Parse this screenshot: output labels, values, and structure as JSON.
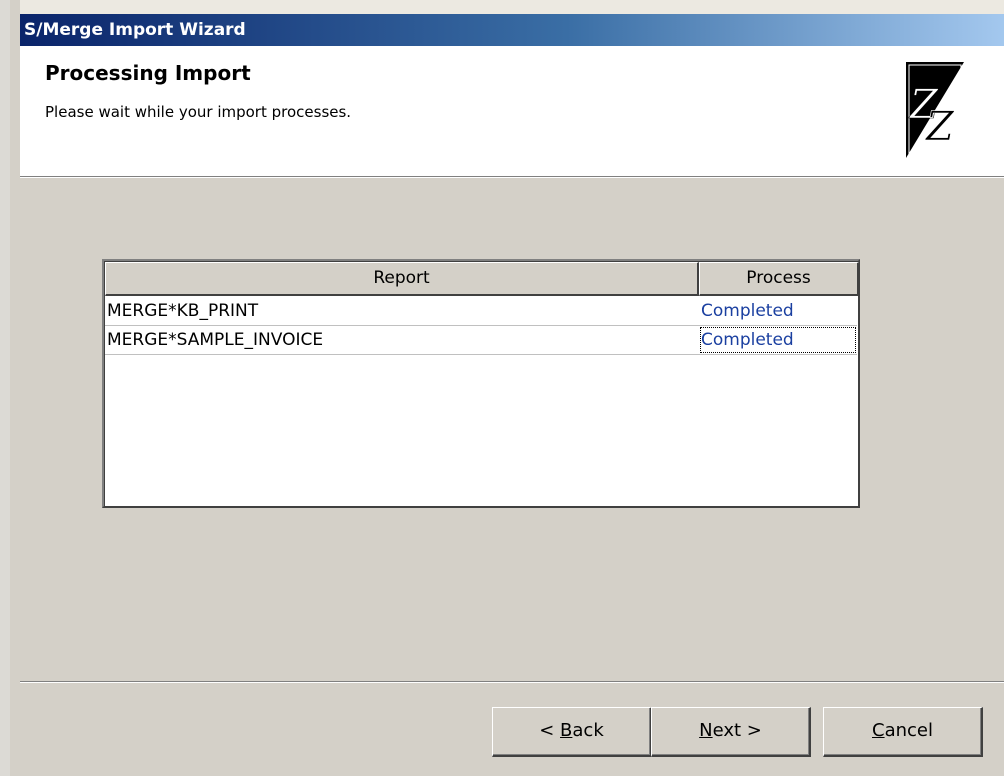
{
  "window": {
    "title": "S/Merge Import Wizard"
  },
  "header": {
    "title": "Processing Import",
    "subtitle": "Please wait while your import processes.",
    "logo_icon": "zz-logo-icon"
  },
  "report_list": {
    "columns": [
      "Report",
      "Process"
    ],
    "rows": [
      {
        "report": "MERGE*KB_PRINT",
        "process": "Completed"
      },
      {
        "report": "MERGE*SAMPLE_INVOICE",
        "process": "Completed"
      }
    ]
  },
  "buttons": {
    "back": {
      "prefix": "< ",
      "mnemonic": "B",
      "rest": "ack"
    },
    "next": {
      "mnemonic": "N",
      "rest": "ext >"
    },
    "cancel": {
      "mnemonic": "C",
      "rest": "ancel"
    }
  },
  "colors": {
    "title_gradient_start": "#0a246a",
    "title_gradient_end": "#a6caf0",
    "process_text": "#1a3fa0",
    "dialog_face": "#d4d0c8"
  }
}
